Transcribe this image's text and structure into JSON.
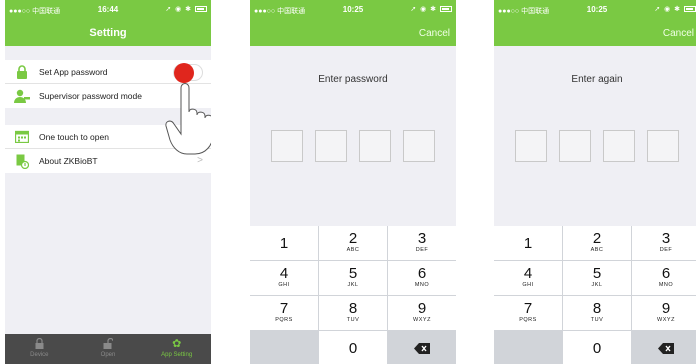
{
  "settings_screen": {
    "status": {
      "carrier": "●●●○○ 中国联通",
      "time": "16:44"
    },
    "title": "Setting",
    "items": [
      {
        "label": "Set App password",
        "icon": "lock-icon",
        "toggle_on": true
      },
      {
        "label": "Supervisor password mode",
        "icon": "supervisor-user-icon"
      },
      {
        "label": "One touch to open",
        "icon": "calendar-icon"
      },
      {
        "label": "About ZKBioBT",
        "icon": "info-document-icon",
        "chevron": ">"
      }
    ],
    "tabs": [
      {
        "label": "Device",
        "icon": "lock-icon"
      },
      {
        "label": "Open",
        "icon": "unlock-icon"
      },
      {
        "label": "App Setting",
        "icon": "gear-icon",
        "active": true
      }
    ]
  },
  "enter_password_screen": {
    "status": {
      "carrier": "●●●○○ 中国联通",
      "time": "10:25"
    },
    "cancel": "Cancel",
    "prompt": "Enter password"
  },
  "enter_again_screen": {
    "status": {
      "carrier": "●●●○○ 中国联通",
      "time": "10:25"
    },
    "cancel": "Cancel",
    "prompt": "Enter again"
  },
  "keypad": {
    "keys": [
      {
        "digit": "1",
        "letters": ""
      },
      {
        "digit": "2",
        "letters": "ABC"
      },
      {
        "digit": "3",
        "letters": "DEF"
      },
      {
        "digit": "4",
        "letters": "GHI"
      },
      {
        "digit": "5",
        "letters": "JKL"
      },
      {
        "digit": "6",
        "letters": "MNO"
      },
      {
        "digit": "7",
        "letters": "PQRS"
      },
      {
        "digit": "8",
        "letters": "TUV"
      },
      {
        "digit": "9",
        "letters": "WXYZ"
      },
      {
        "digit": "0",
        "letters": ""
      }
    ]
  },
  "colors": {
    "accent": "#7ac943",
    "toggle": "#e0261d",
    "tabbar": "#4a4a4a"
  }
}
